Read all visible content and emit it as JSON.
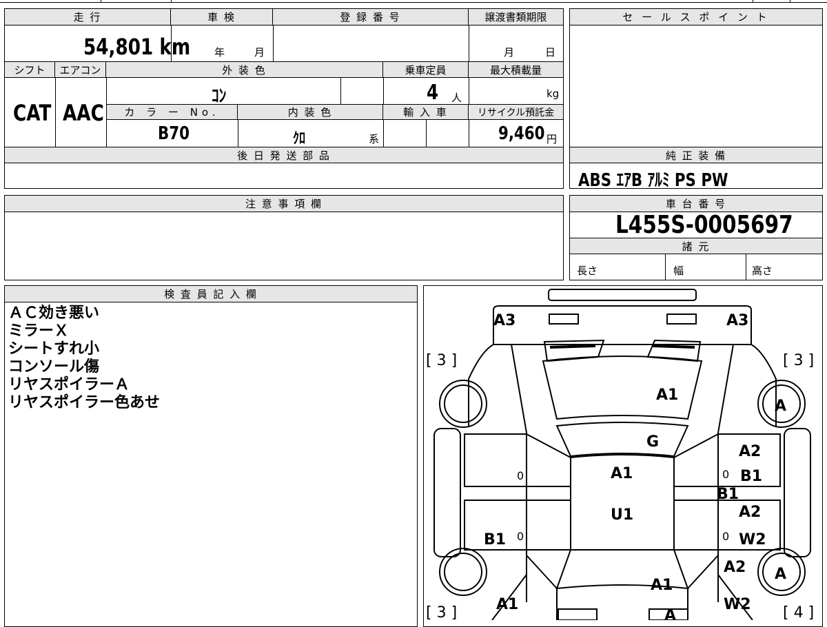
{
  "vehicle": {
    "mileage": "54,801 km",
    "inspection": {
      "year_unit": "年",
      "month_unit": "月"
    },
    "registration_number": "",
    "transfer_deadline": {
      "month_unit": "月",
      "day_unit": "日"
    },
    "shift": "CAT",
    "aircon": "AAC",
    "exterior_color": "ｺﾝ",
    "capacity": "4",
    "capacity_unit": "人",
    "max_load_unit": "kg",
    "color_no": "B70",
    "interior_color": "ｸﾛ",
    "interior_suffix": "系",
    "recycle_fee": "9,460",
    "recycle_unit": "円",
    "frame_number": "L455S-0005697",
    "equipment": "ABS ｴｱB ｱﾙﾐ PS PW"
  },
  "labels": {
    "mileage": "走 行",
    "inspection": "車 検",
    "registration": "登 録 番 号",
    "transfer_deadline": "譲渡書類期限",
    "sales_point": "セ ー ル ス ポ イ ン ト",
    "shift": "シフト",
    "aircon": "エアコン",
    "exterior_color": "外 装 色",
    "capacity": "乗車定員",
    "max_load": "最大積載量",
    "color_no": "カ ラ ー No.",
    "interior_color": "内 装 色",
    "import": "輸 入 車",
    "recycle": "リサイクル預託金",
    "later_parts": "後 日 発 送 部 品",
    "equipment": "純 正 装 備",
    "caution": "注 意 事 項 欄",
    "frame": "車 台 番 号",
    "specs": "諸 元",
    "length": "長さ",
    "width": "幅",
    "height": "高さ",
    "inspector": "検 査 員 記 入 欄"
  },
  "inspector_notes": [
    "ＡＣ効き悪い",
    "ミラーＸ",
    "シートすれ小",
    "コンソール傷",
    "リヤスポイラーＡ",
    "リヤスポイラー色あせ"
  ],
  "diagram_marks": {
    "front_left_corner": "A3",
    "front_right_corner": "A3",
    "tire_fl": "[ 3 ]",
    "tire_fr": "[ 3 ]",
    "tire_rl": "[ 3 ]",
    "tire_rr": "[ 4 ]",
    "wheel_fr": "A",
    "wheel_rr": "A",
    "hood": "A1",
    "windshield": "G",
    "roof_front": "A1",
    "roof_rear": "U1",
    "right_front_door_upper": "A2",
    "right_front_door_lower": "B1",
    "right_sill": "B1",
    "right_rear_door_upper": "A2",
    "right_rear_door_lower": "W2",
    "left_rear_door": "B1",
    "right_rear_quarter": "A2",
    "rear_gate": "A1",
    "left_rear_bumper": "A1",
    "right_rear_bumper": "W2",
    "rear_center": "A",
    "door_zero_1": "0",
    "door_zero_2": "0",
    "door_zero_3": "0",
    "door_zero_4": "0"
  }
}
